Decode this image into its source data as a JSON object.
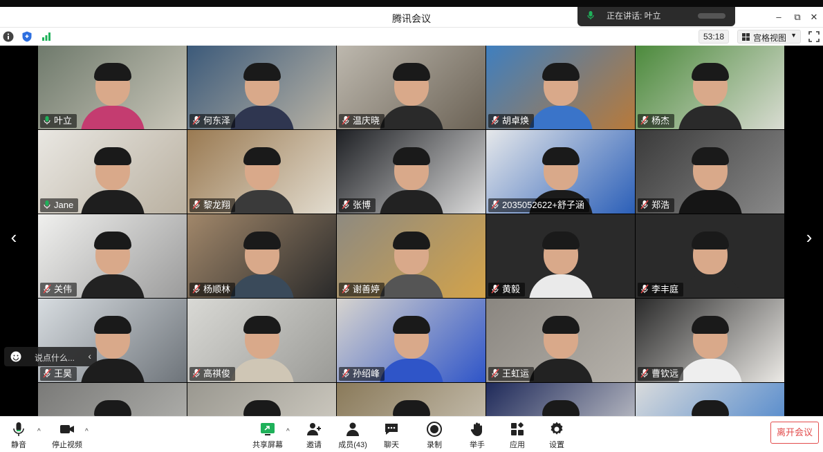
{
  "app": {
    "title": "腾讯会议"
  },
  "speaking": {
    "text": "正在讲话: 叶立"
  },
  "window": {
    "minimize": "–",
    "maximize": "⧉",
    "close": "✕"
  },
  "infobar": {
    "timer": "53:18",
    "view_label": "宫格视图",
    "view_caret": "▼"
  },
  "participants": [
    {
      "name": "叶立",
      "mic": "on",
      "bg": [
        "#6f7a6c",
        "#c9c6b9"
      ],
      "shirt": "#c43c70"
    },
    {
      "name": "何东泽",
      "mic": "off",
      "bg": [
        "#3c5a7a",
        "#b9b3a5"
      ],
      "shirt": "#2f3650"
    },
    {
      "name": "温庆晓",
      "mic": "off",
      "bg": [
        "#bdb8ae",
        "#6b6255"
      ],
      "shirt": "#2a2a2a"
    },
    {
      "name": "胡卓焕",
      "mic": "off",
      "bg": [
        "#3f7fbf",
        "#b87a3a"
      ],
      "shirt": "#3a74c9"
    },
    {
      "name": "杨杰",
      "mic": "off",
      "bg": [
        "#4c8a3c",
        "#d9dcd2"
      ],
      "shirt": "#2a2a2a"
    },
    {
      "name": "Jane",
      "mic": "on",
      "bg": [
        "#e9e7e2",
        "#b9b0a0"
      ],
      "shirt": "#1e1e1e"
    },
    {
      "name": "黎龙翔",
      "mic": "off",
      "bg": [
        "#9a7a52",
        "#e3ddd0"
      ],
      "shirt": "#3a3a3a"
    },
    {
      "name": "张博",
      "mic": "off",
      "bg": [
        "#1e2024",
        "#dcdcdc"
      ],
      "shirt": "#222"
    },
    {
      "name": "2035052622+舒子涵",
      "mic": "off",
      "bg": [
        "#e6e8ea",
        "#2b5fb8"
      ],
      "shirt": "#1b1b1b"
    },
    {
      "name": "郑浩",
      "mic": "off",
      "bg": [
        "#3a3a3a",
        "#8a8a8a"
      ],
      "shirt": "#151515"
    },
    {
      "name": "关伟",
      "mic": "off",
      "bg": [
        "#f0f0ee",
        "#9b9b9b"
      ],
      "shirt": "#222"
    },
    {
      "name": "杨顺林",
      "mic": "off",
      "bg": [
        "#a1876a",
        "#2a2a2a"
      ],
      "shirt": "#3a4a5a"
    },
    {
      "name": "谢善婷",
      "mic": "off",
      "bg": [
        "#8e8a80",
        "#d3a34a"
      ],
      "shirt": "#555"
    },
    {
      "name": "黄毅",
      "mic": "off",
      "bg": [
        "#2a2a2a",
        "#2a2a2a"
      ],
      "shirt": "#eaeaea"
    },
    {
      "name": "李丰庭",
      "mic": "off",
      "bg": [
        "#2a2a2a",
        "#2a2a2a"
      ],
      "shirt": "#2a2a2a"
    },
    {
      "name": "王昊",
      "mic": "off",
      "bg": [
        "#d7dce0",
        "#6e747a"
      ],
      "shirt": "#1d1d1d"
    },
    {
      "name": "高祺俊",
      "mic": "off",
      "bg": [
        "#d9d9d5",
        "#9a9a96"
      ],
      "shirt": "#cfc6b5"
    },
    {
      "name": "孙绍峰",
      "mic": "off",
      "bg": [
        "#d7d4cf",
        "#2f55c8"
      ],
      "shirt": "#2f55c8"
    },
    {
      "name": "王虹运",
      "mic": "off",
      "bg": [
        "#8a8680",
        "#b6b2ab"
      ],
      "shirt": "#222"
    },
    {
      "name": "曹钦远",
      "mic": "off",
      "bg": [
        "#2a2a2a",
        "#eceae6"
      ],
      "shirt": "#eeeeee"
    },
    {
      "name": "",
      "mic": "",
      "bg": [
        "#7a7a78",
        "#b8b8b4"
      ],
      "shirt": "#555"
    },
    {
      "name": "",
      "mic": "",
      "bg": [
        "#9a9890",
        "#d6d2c8"
      ],
      "shirt": "#333"
    },
    {
      "name": "",
      "mic": "",
      "bg": [
        "#8a7a5a",
        "#cfc9bc"
      ],
      "shirt": "#444"
    },
    {
      "name": "",
      "mic": "",
      "bg": [
        "#1f2a5a",
        "#d8d8d8"
      ],
      "shirt": "#222"
    },
    {
      "name": "",
      "mic": "",
      "bg": [
        "#d9dbdc",
        "#3a7ac9"
      ],
      "shirt": "#333"
    }
  ],
  "chat": {
    "placeholder": "说点什么...",
    "caret": "‹"
  },
  "nav": {
    "prev": "‹",
    "next": "›"
  },
  "toolbar": {
    "mute": "静音",
    "stop_video": "停止视频",
    "share_screen": "共享屏幕",
    "invite": "邀请",
    "members": "成员(43)",
    "chat": "聊天",
    "record": "录制",
    "raise_hand": "举手",
    "apps": "应用",
    "settings": "设置",
    "leave": "离开会议",
    "caret": "^"
  },
  "colors": {
    "accent_green": "#1fb15a",
    "leave_red": "#e24a4a",
    "info_blue": "#2d6fe0"
  }
}
